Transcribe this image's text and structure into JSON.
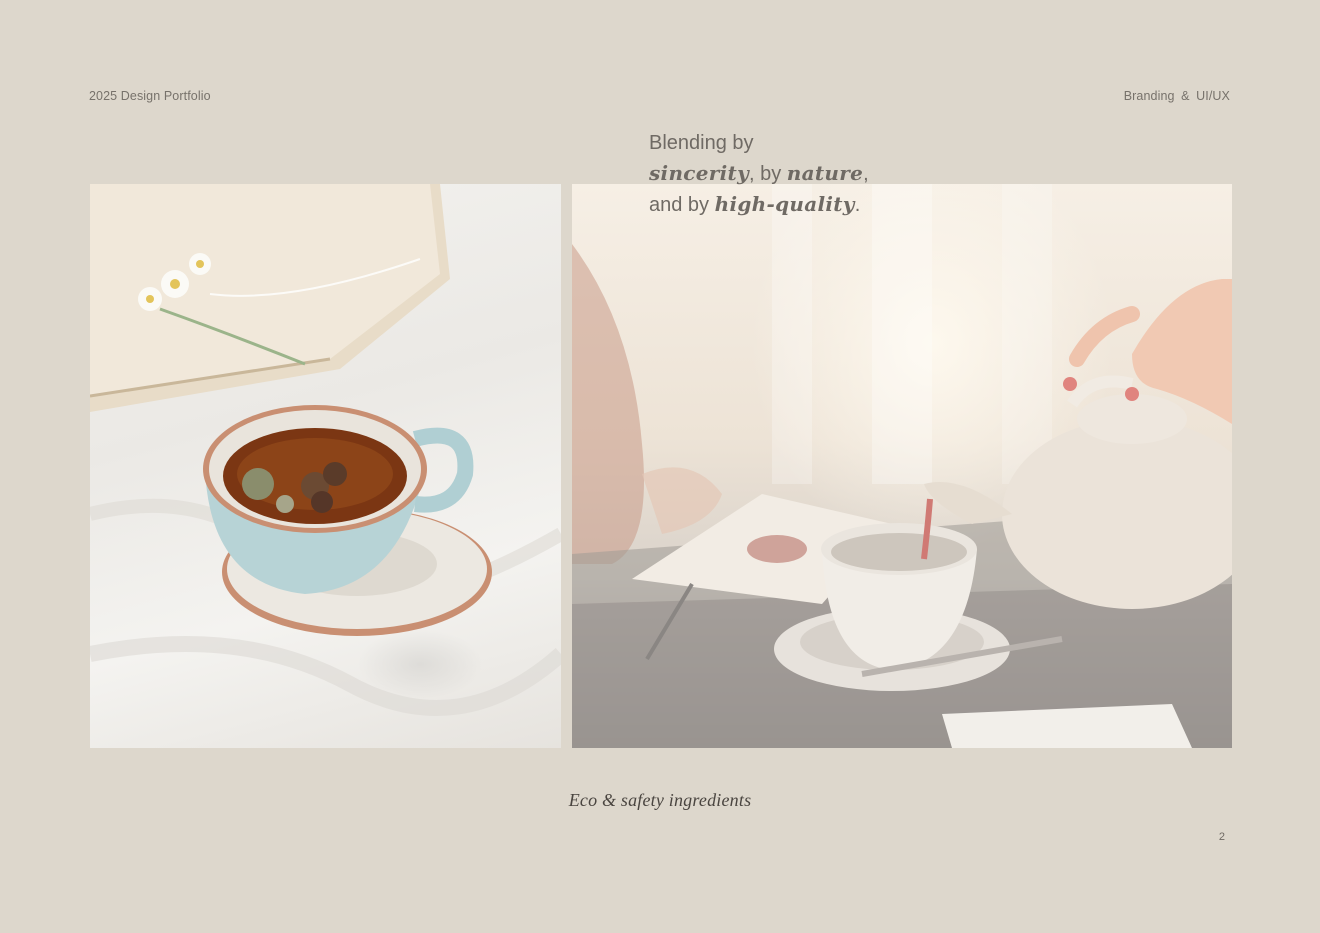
{
  "header": {
    "left_label": "2025 Design Portfolio",
    "right_label": "Branding & UI/UX"
  },
  "headline": {
    "line1": "Blending by",
    "line2_em1": "sincerity",
    "line2_mid": ", by ",
    "line2_em2": "nature",
    "line2_end": ",",
    "line3_start": "and by ",
    "line3_em": "high-quality",
    "line3_end": "."
  },
  "caption": "Eco & safety ingredients",
  "page_number": "2",
  "colors": {
    "background": "#ddd7cc",
    "text": "#6f6a64",
    "caption_text": "#4a4540"
  }
}
